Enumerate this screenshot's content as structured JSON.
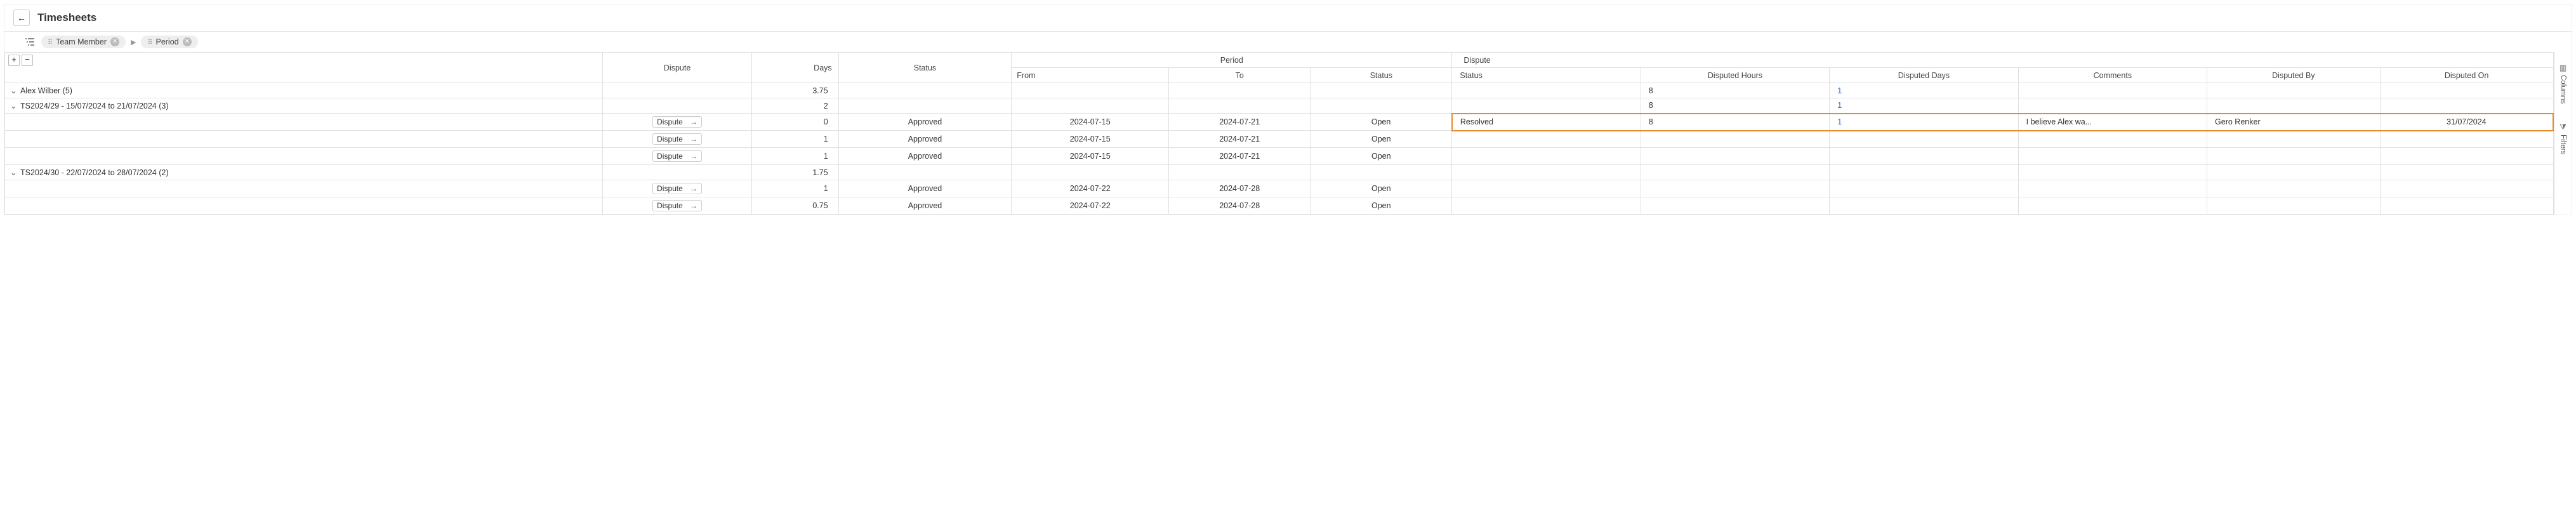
{
  "header": {
    "title": "Timesheets"
  },
  "toolbar": {
    "group1": "Team Member",
    "group2": "Period"
  },
  "columns": {
    "dispute_action": "Dispute",
    "days": "Days",
    "status": "Status",
    "period_group": "Period",
    "from": "From",
    "to": "To",
    "period_status": "Status",
    "dispute_group": "Dispute",
    "dispute_status": "Status",
    "disputed_hours": "Disputed Hours",
    "disputed_days": "Disputed Days",
    "comments": "Comments",
    "disputed_by": "Disputed By",
    "disputed_on": "Disputed On"
  },
  "buttons": {
    "dispute": "Dispute"
  },
  "rows": {
    "member": {
      "label": "Alex Wilber (5)",
      "days": "3.75",
      "dhrs": "8",
      "ddays": "1"
    },
    "period1": {
      "label": "TS2024/29 - 15/07/2024 to 21/07/2024 (3)",
      "days": "2",
      "dhrs": "8",
      "ddays": "1"
    },
    "r1": {
      "days": "0",
      "status": "Approved",
      "from": "2024-07-15",
      "to": "2024-07-21",
      "pstat": "Open",
      "dstat": "Resolved",
      "dhrs": "8",
      "ddays": "1",
      "comments": "I believe Alex wa...",
      "dby": "Gero Renker",
      "don": "31/07/2024"
    },
    "r2": {
      "days": "1",
      "status": "Approved",
      "from": "2024-07-15",
      "to": "2024-07-21",
      "pstat": "Open"
    },
    "r3": {
      "days": "1",
      "status": "Approved",
      "from": "2024-07-15",
      "to": "2024-07-21",
      "pstat": "Open"
    },
    "period2": {
      "label": "TS2024/30 - 22/07/2024 to 28/07/2024 (2)",
      "days": "1.75"
    },
    "r4": {
      "days": "1",
      "status": "Approved",
      "from": "2024-07-22",
      "to": "2024-07-28",
      "pstat": "Open"
    },
    "r5": {
      "days": "0.75",
      "status": "Approved",
      "from": "2024-07-22",
      "to": "2024-07-28",
      "pstat": "Open"
    }
  },
  "rail": {
    "columns": "Columns",
    "filters": "Filters"
  }
}
